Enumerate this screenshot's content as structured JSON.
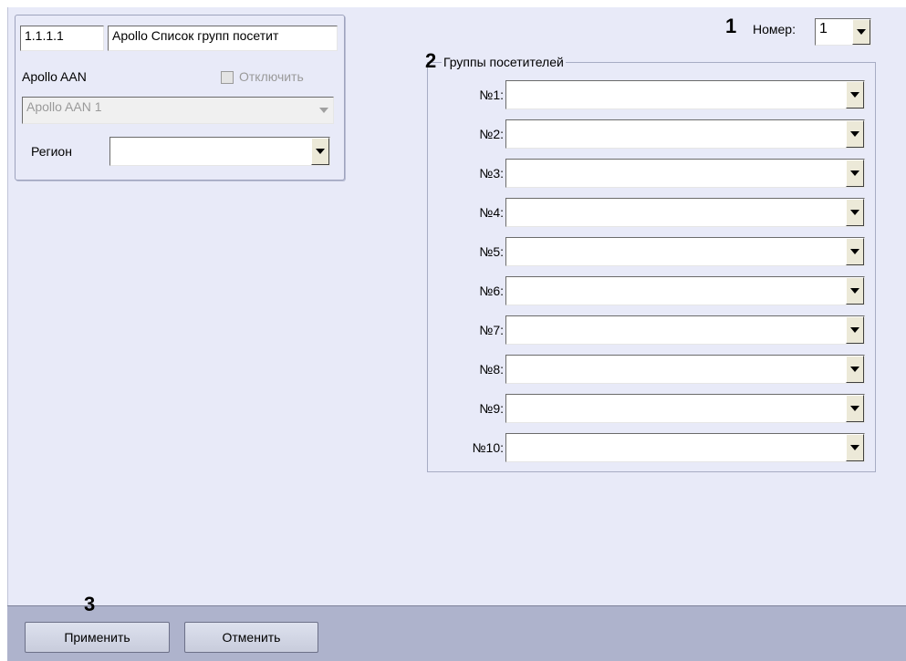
{
  "top_caption": "",
  "left_panel": {
    "id_value": "1.1.1.1",
    "name_value": "Apollo Список групп посетит",
    "aan_label": "Apollo AAN",
    "disable_label": "Отключить",
    "aan_select_value": "Apollo AAN 1",
    "region_label": "Регион",
    "region_value": ""
  },
  "number": {
    "label": "Номер:",
    "value": "1"
  },
  "groups": {
    "title": "Группы посетителей",
    "rows": [
      {
        "label": "№1:",
        "value": ""
      },
      {
        "label": "№2:",
        "value": ""
      },
      {
        "label": "№3:",
        "value": ""
      },
      {
        "label": "№4:",
        "value": ""
      },
      {
        "label": "№5:",
        "value": ""
      },
      {
        "label": "№6:",
        "value": ""
      },
      {
        "label": "№7:",
        "value": ""
      },
      {
        "label": "№8:",
        "value": ""
      },
      {
        "label": "№9:",
        "value": ""
      },
      {
        "label": "№10:",
        "value": ""
      }
    ]
  },
  "callouts": {
    "c1": "1",
    "c2": "2",
    "c3": "3"
  },
  "buttons": {
    "apply": "Применить",
    "cancel": "Отменить"
  },
  "colors": {
    "panel": "#e8eaf8",
    "bottom_bar": "#aeb3cc"
  }
}
